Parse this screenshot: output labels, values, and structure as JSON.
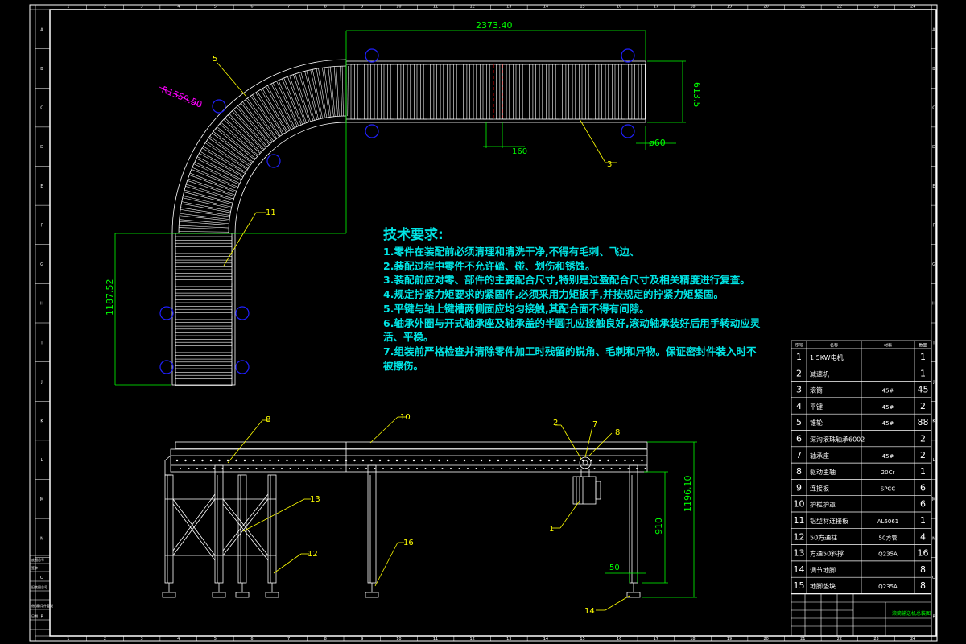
{
  "drawing": {
    "colors": {
      "background": "#000000",
      "frame": "#ffffff",
      "dimension": "#00ff00",
      "leader": "#ffff00",
      "note": "#00e5e5",
      "radius": "#ff00ff",
      "bolt": "#0000ff",
      "center": "#ff0000"
    },
    "grid_top": [
      "1",
      "2",
      "3",
      "4",
      "5",
      "6",
      "7",
      "8",
      "9",
      "10",
      "11",
      "12",
      "13",
      "14",
      "15",
      "16",
      "17",
      "18",
      "19",
      "20",
      "21",
      "22",
      "23",
      "24"
    ],
    "grid_side": [
      "A",
      "B",
      "C",
      "D",
      "E",
      "F",
      "G",
      "H",
      "I",
      "J",
      "K",
      "L",
      "M",
      "N",
      "O",
      "P"
    ]
  },
  "dimensions": {
    "overall_length": "2373.40",
    "width": "613.5",
    "roller_pitch": "160",
    "roller_dia": "ø60",
    "radius": "R1559.50",
    "side_length": "1187.52",
    "height_total": "1196.10",
    "height_leg": "910",
    "foot_offset": "50"
  },
  "balloons": {
    "b1": "1",
    "b2": "2",
    "b3": "3",
    "b5": "5",
    "b7": "7",
    "b8": "8",
    "b8b": "8",
    "b10": "10",
    "b11": "11",
    "b12": "12",
    "b13": "13",
    "b14": "14",
    "b16": "16"
  },
  "notes": {
    "title": "技术要求:",
    "lines": [
      "1.零件在装配前必须清理和清洗干净,不得有毛刺、飞边、",
      "2.装配过程中零件不允许磕、碰、划伤和锈蚀。",
      "3.装配前应对零、部件的主要配合尺寸,特别是过盈配合尺寸及相关精度进行复查。",
      "4.规定拧紧力矩要求的紧固件,必须采用力矩扳手,并按规定的拧紧力矩紧固。",
      "5.平键与轴上键槽两侧面应均匀接触,其配合面不得有间隙。",
      "6.轴承外圈与开式轴承座及轴承盖的半圆孔应接触良好,滚动轴承装好后用手转动应灵活、平稳。",
      "7.组装前严格检查并清除零件加工时残留的锐角、毛刺和异物。保证密封件装入时不被擦伤。"
    ]
  },
  "bom": {
    "headers": [
      "序号",
      "名称",
      "材料",
      "数量"
    ],
    "rows": [
      {
        "no": "1",
        "name": "1.5KW电机",
        "mat": "",
        "qty": "1"
      },
      {
        "no": "2",
        "name": "减速机",
        "mat": "",
        "qty": "1"
      },
      {
        "no": "3",
        "name": "滚筒",
        "mat": "45#",
        "qty": "45"
      },
      {
        "no": "4",
        "name": "平键",
        "mat": "45#",
        "qty": "2"
      },
      {
        "no": "5",
        "name": "锥轮",
        "mat": "45#",
        "qty": "88"
      },
      {
        "no": "6",
        "name": "深沟滚珠轴承6002",
        "mat": "",
        "qty": "2"
      },
      {
        "no": "7",
        "name": "轴承座",
        "mat": "45#",
        "qty": "2"
      },
      {
        "no": "8",
        "name": "驱动主轴",
        "mat": "20Cr",
        "qty": "1"
      },
      {
        "no": "9",
        "name": "连接板",
        "mat": "SPCC",
        "qty": "6"
      },
      {
        "no": "10",
        "name": "护栏护罩",
        "mat": "",
        "qty": "6"
      },
      {
        "no": "11",
        "name": "铝型材连接板",
        "mat": "AL6061",
        "qty": "1"
      },
      {
        "no": "12",
        "name": "50方通柱",
        "mat": "50方管",
        "qty": "4"
      },
      {
        "no": "13",
        "name": "方通50斜撑",
        "mat": "Q235A",
        "qty": "16"
      },
      {
        "no": "14",
        "name": "调节地脚",
        "mat": "",
        "qty": "8"
      },
      {
        "no": "15",
        "name": "地脚垫块",
        "mat": "Q235A",
        "qty": "8"
      }
    ]
  },
  "title_block": {
    "drawing_title": "滚筒输送机总装图"
  },
  "left_stamp": [
    "底图总号",
    "签字",
    "日期",
    "旧底图总号",
    "借(通)用件登记"
  ]
}
